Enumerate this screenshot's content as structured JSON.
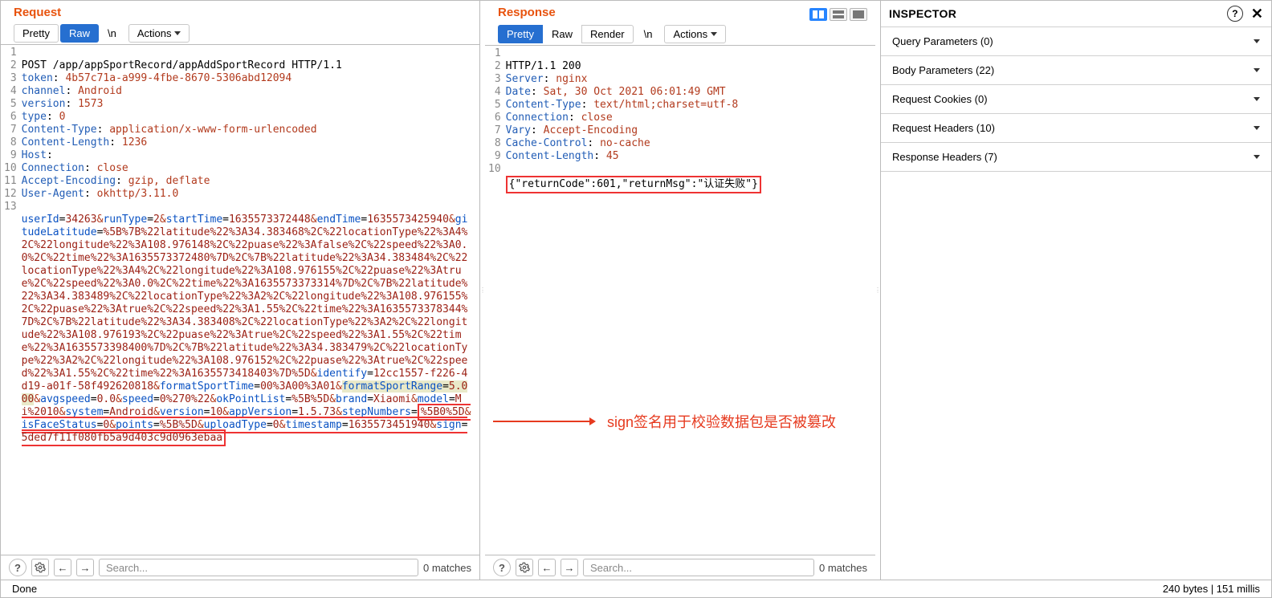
{
  "request": {
    "title": "Request",
    "tabs": {
      "pretty": "Pretty",
      "raw": "Raw",
      "newline": "\\n",
      "actions": "Actions"
    },
    "active_tab": "Raw",
    "lines": {
      "l1": "POST /app/appSportRecord/appAddSportRecord HTTP/1.1",
      "headers": [
        {
          "k": "token",
          "v": "4b57c71a-a999-4fbe-8670-5306abd12094"
        },
        {
          "k": "channel",
          "v": "Android"
        },
        {
          "k": "version",
          "v": "1573"
        },
        {
          "k": "type",
          "v": "0"
        },
        {
          "k": "Content-Type",
          "v": "application/x-www-form-urlencoded"
        },
        {
          "k": "Content-Length",
          "v": "1236"
        },
        {
          "k": "Host",
          "v": "            "
        },
        {
          "k": "Connection",
          "v": "close"
        },
        {
          "k": "Accept-Encoding",
          "v": "gzip, deflate"
        },
        {
          "k": "User-Agent",
          "v": "okhttp/3.11.0"
        }
      ],
      "body": {
        "p1": "userId",
        "v1": "34263",
        "p2": "runType",
        "v2": "2",
        "p3": "startTime",
        "v3": "1635573372448",
        "p4": "endTime",
        "v4": "1635573425940",
        "p5": "gitudeLatitude",
        "v5": "%5B%7B%22latitude%22%3A34.383468%2C%22locationType%22%3A4%2C%22longitude%22%3A108.976148%2C%22puase%22%3Afalse%2C%22speed%22%3A0.0%2C%22time%22%3A1635573372480%7D%2C%7B%22latitude%22%3A34.383484%2C%22locationType%22%3A4%2C%22longitude%22%3A108.976155%2C%22puase%22%3Atrue%2C%22speed%22%3A0.0%2C%22time%22%3A1635573373314%7D%2C%7B%22latitude%22%3A34.383489%2C%22locationType%22%3A2%2C%22longitude%22%3A108.976155%2C%22puase%22%3Atrue%2C%22speed%22%3A1.55%2C%22time%22%3A1635573378344%7D%2C%7B%22latitude%22%3A34.383408%2C%22locationType%22%3A2%2C%22longitude%22%3A108.976193%2C%22puase%22%3Atrue%2C%22speed%22%3A1.55%2C%22time%22%3A1635573398400%7D%2C%7B%22latitude%22%3A34.383479%2C%22locationType%22%3A2%2C%22longitude%22%3A108.976152%2C%22puase%22%3Atrue%2C%22speed%22%3A1.55%2C%22time%22%3A1635573418403%7D%5D",
        "p6": "identify",
        "v6": "12cc1557-f226-4d19-a01f-58f492620818",
        "p7": "formatSportTime",
        "v7": "00%3A00%3A01",
        "p8": "formatSportRange",
        "v8": "5.000",
        "p9": "avgspeed",
        "v9": "0.0",
        "p10": "speed",
        "v10": "0%270%22",
        "p11": "okPointList",
        "v11": "%5B%5D",
        "p12": "brand",
        "v12": "Xiaomi",
        "p13": "model",
        "v13": "Mi%2010",
        "p14": "system",
        "v14": "Android",
        "p15": "version",
        "v15": "10",
        "p16": "appVersion",
        "v16": "1.5.73",
        "p17": "stepNumbers",
        "v17": "%5B0%5D",
        "p18": "isFaceStatus",
        "v18": "0",
        "p19": "points",
        "v19": "%5B%5D",
        "p20": "uploadType",
        "v20": "0",
        "p21": "timestamp",
        "v21": "1635573451940",
        "p22": "sign",
        "v22": "5ded7f11f080fb5a9d403c9d0963ebaa"
      }
    },
    "search_placeholder": "Search...",
    "matches": "0 matches"
  },
  "response": {
    "title": "Response",
    "tabs": {
      "pretty": "Pretty",
      "raw": "Raw",
      "render": "Render",
      "newline": "\\n",
      "actions": "Actions"
    },
    "active_tab": "Pretty",
    "status_line": "HTTP/1.1 200",
    "headers": [
      {
        "k": "Server",
        "v": "nginx"
      },
      {
        "k": "Date",
        "v": "Sat, 30 Oct 2021 06:01:49 GMT"
      },
      {
        "k": "Content-Type",
        "v": "text/html;charset=utf-8"
      },
      {
        "k": "Connection",
        "v": "close"
      },
      {
        "k": "Vary",
        "v": "Accept-Encoding"
      },
      {
        "k": "Cache-Control",
        "v": "no-cache"
      },
      {
        "k": "Content-Length",
        "v": "45"
      }
    ],
    "body_json": "{\"returnCode\":601,\"returnMsg\":\"认证失败\"}",
    "search_placeholder": "Search...",
    "matches": "0 matches",
    "annotation": "sign签名用于校验数据包是否被篡改"
  },
  "inspector": {
    "title": "INSPECTOR",
    "sections": [
      {
        "label": "Query Parameters",
        "count": 0
      },
      {
        "label": "Body Parameters",
        "count": 22
      },
      {
        "label": "Request Cookies",
        "count": 0
      },
      {
        "label": "Request Headers",
        "count": 10
      },
      {
        "label": "Response Headers",
        "count": 7
      }
    ]
  },
  "status": {
    "left": "Done",
    "right": "240 bytes | 151 millis"
  }
}
